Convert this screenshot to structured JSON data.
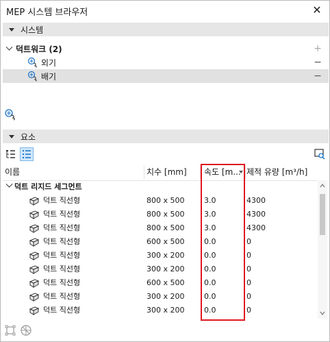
{
  "window": {
    "title": "MEP 시스템 브라우저",
    "close_icon": "close-icon"
  },
  "systems_section": {
    "header": "시스템",
    "group": {
      "label": "덕트워크 (2)",
      "add_symbol": "+"
    },
    "items": [
      {
        "label": "외기",
        "remove_symbol": "−",
        "selected": false
      },
      {
        "label": "배기",
        "remove_symbol": "−",
        "selected": true
      }
    ]
  },
  "elements_section": {
    "header": "요소"
  },
  "table": {
    "columns": [
      {
        "label": "이름"
      },
      {
        "label": "치수 [mm]"
      },
      {
        "label": "속도 [m..."
      },
      {
        "label": "제적 유량 [m³/h]"
      }
    ],
    "group_label": "덕트 리지드 세그먼트",
    "rows": [
      {
        "name": "덕트 직선형",
        "size": "800 x 500",
        "velocity": "3.0",
        "flow": "4300"
      },
      {
        "name": "덕트 직선형",
        "size": "800 x 500",
        "velocity": "3.0",
        "flow": "4300"
      },
      {
        "name": "덕트 직선형",
        "size": "800 x 500",
        "velocity": "3.0",
        "flow": "4300"
      },
      {
        "name": "덕트 직선형",
        "size": "600 x 500",
        "velocity": "0.0",
        "flow": "0"
      },
      {
        "name": "덕트 직선형",
        "size": "300 x 200",
        "velocity": "0.0",
        "flow": "0"
      },
      {
        "name": "덕트 직선형",
        "size": "300 x 200",
        "velocity": "0.0",
        "flow": "0"
      },
      {
        "name": "덕트 직선형",
        "size": "600 x 500",
        "velocity": "0.0",
        "flow": "0"
      },
      {
        "name": "덕트 직선형",
        "size": "300 x 200",
        "velocity": "0.0",
        "flow": "0"
      },
      {
        "name": "덕트 직선형",
        "size": "300 x 200",
        "velocity": "0.0",
        "flow": "0"
      }
    ]
  },
  "colors": {
    "highlight": "#e0161f",
    "accent": "#1a73c8",
    "selected_row": "#e1e1e1",
    "section_header": "#e6e6e6"
  }
}
